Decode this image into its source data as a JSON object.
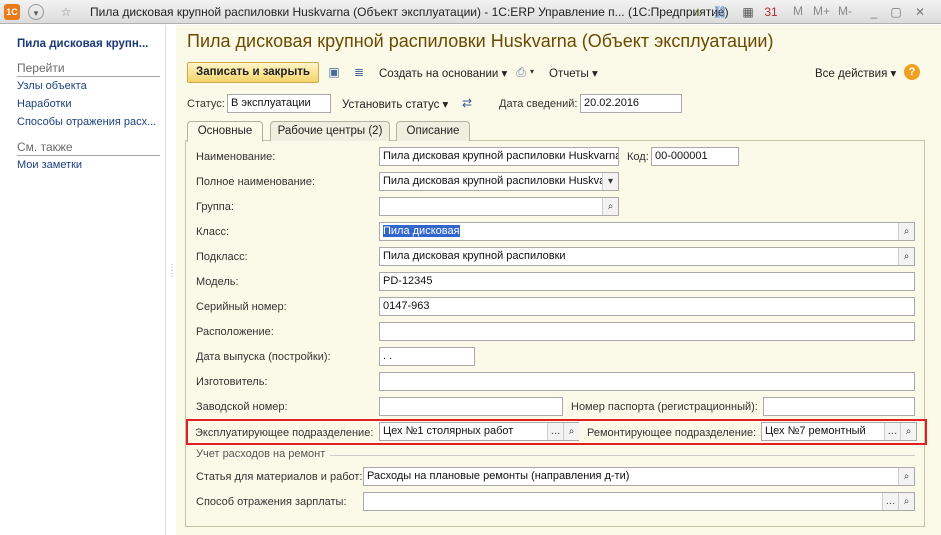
{
  "window": {
    "title": "Пила дисковая крупной распиловки Huskvarna (Объект эксплуатации) - 1С:ERP Управление п... (1С:Предприятие)",
    "right_buttons": [
      "M",
      "M+",
      "M-"
    ]
  },
  "left_panel": {
    "title": "Пила дисковая крупн...",
    "goto_header": "Перейти",
    "goto_items": [
      "Узлы объекта",
      "Наработки",
      "Способы отражения расх..."
    ],
    "see_also_header": "См. также",
    "see_also_items": [
      "Мои заметки"
    ]
  },
  "form": {
    "title": "Пила дисковая крупной распиловки Huskvarna (Объект эксплуатации)",
    "toolbar": {
      "save_close": "Записать и закрыть",
      "create_based": "Создать на основании",
      "reports": "Отчеты",
      "all_actions": "Все действия",
      "help": "?"
    },
    "status_label": "Статус:",
    "status_value": "В эксплуатации",
    "set_status": "Установить статус",
    "info_date_label": "Дата сведений:",
    "info_date_value": "20.02.2016",
    "tabs": [
      "Основные",
      "Рабочие центры (2)",
      "Описание"
    ],
    "fields": {
      "name_label": "Наименование:",
      "name_value": "Пила дисковая крупной распиловки Huskvarna",
      "code_label": "Код:",
      "code_value": "00-000001",
      "full_name_label": "Полное наименование:",
      "full_name_value": "Пила дисковая крупной распиловки Huskvarna",
      "group_label": "Группа:",
      "group_value": "",
      "class_label": "Класс:",
      "class_value": "Пила дисковая",
      "subclass_label": "Подкласс:",
      "subclass_value": "Пила дисковая крупной распиловки",
      "model_label": "Модель:",
      "model_value": "PD-12345",
      "serial_label": "Серийный номер:",
      "serial_value": "0147-963",
      "location_label": "Расположение:",
      "location_value": "",
      "release_date_label": "Дата выпуска (постройки):",
      "release_date_value": " .  .",
      "manufacturer_label": "Изготовитель:",
      "manufacturer_value": "",
      "factory_num_label": "Заводской номер:",
      "factory_num_value": "",
      "passport_num_label": "Номер паспорта (регистрационный):",
      "passport_num_value": "",
      "operating_div_label": "Эксплуатирующее подразделение:",
      "operating_div_value": "Цех №1 столярных работ",
      "repair_div_label": "Ремонтирующее подразделение:",
      "repair_div_value": "Цех №7 ремонтный",
      "repair_cost_group": "Учет расходов на ремонт",
      "cost_item_label": "Статья для материалов и работ:",
      "cost_item_value": "Расходы на плановые ремонты (направления д-ти)",
      "salary_method_label": "Способ отражения зарплаты:",
      "salary_method_value": ""
    }
  },
  "colors": {
    "form_bg": "#fbfae9",
    "title_color": "#6b4a00",
    "highlight": "#e02020",
    "primary_button": "#f4d46a",
    "selection": "#3366cc"
  }
}
